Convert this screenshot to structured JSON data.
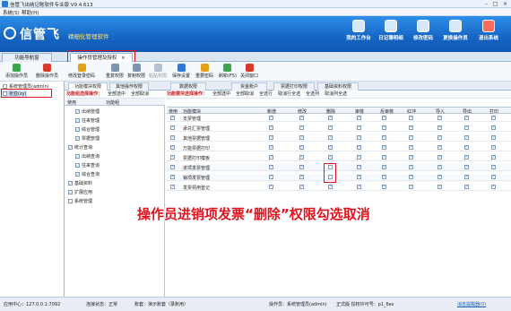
{
  "window": {
    "title": "信管飞出纳记账软件专业版 V9.4.613"
  },
  "menu": [
    "系统(S)",
    "帮助(H)"
  ],
  "banner": {
    "logo": "信管飞",
    "slogan": "精细化管理软件"
  },
  "top_buttons": [
    {
      "label": "我的工作台",
      "icon": "workbench-icon"
    },
    {
      "label": "日记簿明细",
      "icon": "journal-icon"
    },
    {
      "label": "修改密码",
      "icon": "key-icon"
    },
    {
      "label": "更换操作员",
      "icon": "user-switch-icon"
    },
    {
      "label": "退出系统",
      "icon": "power-icon"
    }
  ],
  "tabs": [
    {
      "label": "功能导航窗"
    },
    {
      "label": "操作员管理及授权",
      "close": "×"
    }
  ],
  "toolbar": [
    {
      "label": "添加操作员",
      "color": "#37a84a"
    },
    {
      "label": "删除操作员",
      "color": "#d9392b"
    },
    {
      "label": "修改登录密码",
      "color": "#e3a21a"
    },
    {
      "label": "重复权限",
      "color": "#7f93ad"
    },
    {
      "label": "复制权限",
      "color": "#7f93ad"
    },
    {
      "label": "粘贴权限",
      "color": "#b6c2d2"
    },
    {
      "label": "保存设置",
      "color": "#2f7ad1"
    },
    {
      "label": "重要密码",
      "color": "#e3a21a"
    },
    {
      "label": "刷新(F5)",
      "color": "#37a84a"
    },
    {
      "label": "关闭窗口",
      "color": "#d9392b"
    }
  ],
  "users": [
    "系统管理员(admin)",
    "张亚(zy)"
  ],
  "subtabs": [
    "功能模块权限",
    "其他操作权限",
    "数据权限",
    "资金账户",
    "票据打印权限",
    "基础资料权限"
  ],
  "opbar_left": {
    "title": "功能组选择操作：",
    "all": "全部选中",
    "none": "全部取消"
  },
  "opbar_right": {
    "title": "功能模块选择操作：",
    "all": "全部选中",
    "none": "全部取消",
    "select": "全选行",
    "cancel_row": "取消行全选",
    "select_col": "全选列",
    "cancel_col": "取消列全选"
  },
  "tree_head": [
    "使用",
    "功能组"
  ],
  "tree": [
    {
      "label": "出纳管理",
      "checked": true,
      "indent": 1
    },
    {
      "label": "往来管理",
      "checked": true,
      "indent": 1
    },
    {
      "label": "综合管理",
      "checked": true,
      "indent": 1
    },
    {
      "label": "票据管理",
      "checked": true,
      "indent": 1
    },
    {
      "label": "统计查询",
      "checked": true,
      "indent": 0
    },
    {
      "label": "出纳查询",
      "checked": true,
      "indent": 1
    },
    {
      "label": "往来查询",
      "checked": true,
      "indent": 1
    },
    {
      "label": "综合查询",
      "checked": true,
      "indent": 1
    },
    {
      "label": "基础资料",
      "checked": true,
      "indent": 0
    },
    {
      "label": "扩展应用",
      "checked": true,
      "indent": 0
    },
    {
      "label": "系统管理",
      "checked": false,
      "indent": 0
    }
  ],
  "grid_head": [
    "使用",
    "功能模块",
    "新增",
    "修改",
    "删除",
    "审核",
    "反审核",
    "红冲",
    "导入",
    "导出",
    "打印"
  ],
  "grid_rows": [
    {
      "label": "支票管理",
      "use": true,
      "perms": [
        true,
        true,
        true,
        true,
        true,
        true,
        true,
        true,
        true
      ]
    },
    {
      "label": "承兑汇票管理",
      "use": true,
      "perms": [
        true,
        true,
        true,
        true,
        true,
        true,
        true,
        true,
        true
      ]
    },
    {
      "label": "其他票据管理",
      "use": true,
      "perms": [
        true,
        true,
        true,
        true,
        true,
        true,
        true,
        true,
        true
      ]
    },
    {
      "label": "万能票据打印",
      "use": true,
      "perms": [
        true,
        true,
        true,
        true,
        true,
        true,
        true,
        true,
        true
      ]
    },
    {
      "label": "票据打印模板",
      "use": true,
      "perms": [
        true,
        true,
        true,
        true,
        true,
        true,
        true,
        true,
        true
      ]
    },
    {
      "label": "进项发票管理",
      "use": true,
      "perms": [
        true,
        true,
        false,
        true,
        true,
        true,
        true,
        true,
        true
      ]
    },
    {
      "label": "销项发票管理",
      "use": true,
      "perms": [
        true,
        true,
        false,
        true,
        true,
        true,
        true,
        true,
        true
      ]
    },
    {
      "label": "发票领用登记",
      "use": true,
      "perms": [
        true,
        true,
        true,
        true,
        true,
        true,
        true,
        true,
        true
      ]
    }
  ],
  "annotation": "操作员进销项发票“删除”权限勾选取消",
  "status": {
    "server": "应用中心：127.0.0.1:7092",
    "connection": "连接状态：正常",
    "account": "账套：演示账套（录账用）",
    "operator": "操作员：系统管理员(admin)",
    "edition": "正式版  授权许可号：p1_6es",
    "messages": "消息提醒器(0)"
  }
}
